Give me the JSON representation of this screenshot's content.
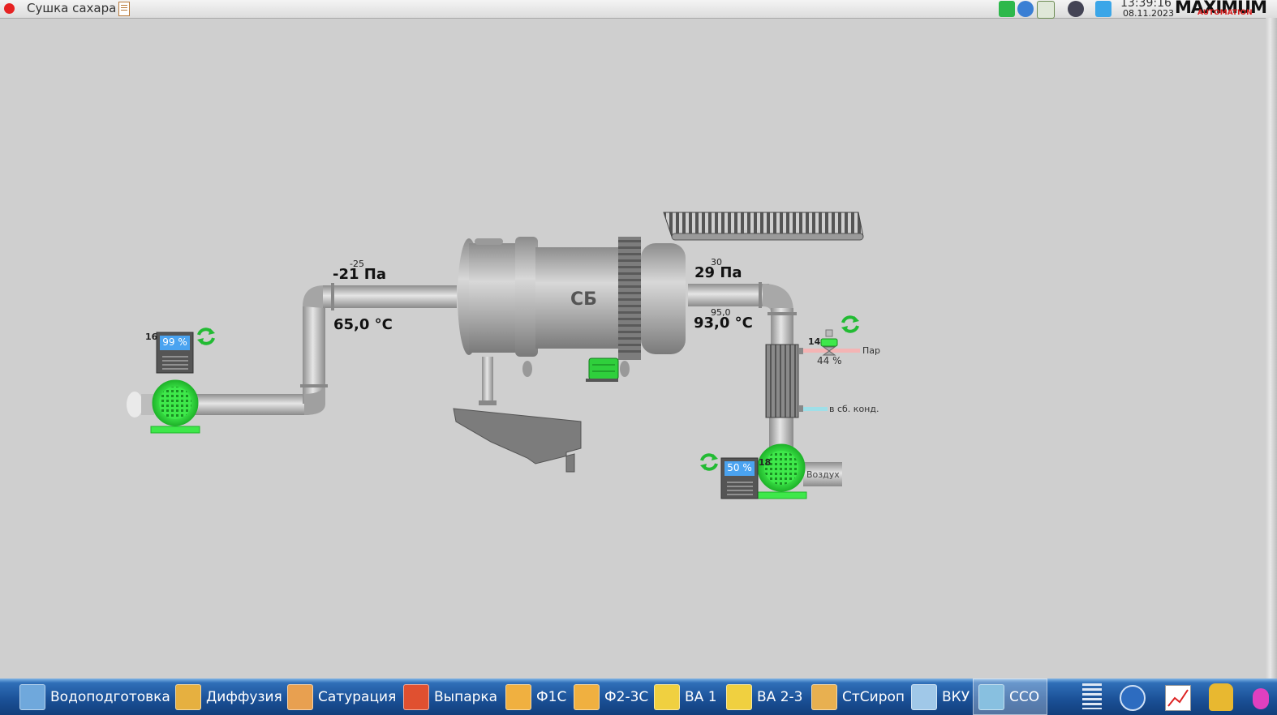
{
  "window": {
    "title": "Сушка сахара"
  },
  "clock": {
    "time": "13:39:16",
    "date": "08.11.2023"
  },
  "logo": {
    "text": "MAXIMUM",
    "subtext": "AUTOMATION"
  },
  "process": {
    "dryer_label": "СБ",
    "inlet": {
      "pressure": "-21 Па",
      "pressure_setpoint": "-25",
      "temperature": "65,0 °C"
    },
    "outlet": {
      "pressure": "29 Па",
      "pressure_setpoint": "30",
      "temperature": "93,0 °C",
      "temperature_setpoint": "95,0"
    },
    "fan_left": {
      "number": "16",
      "speed": "99 %"
    },
    "fan_right": {
      "number": "18",
      "speed": "50 %",
      "air_label": "Воздух"
    },
    "steam_valve": {
      "number": "14",
      "opening": "44 %",
      "steam_label": "Пар",
      "condensate_label": "в сб. конд."
    }
  },
  "taskbar": {
    "items": [
      {
        "label": "Водоподготовка",
        "color": "#6fa8dc"
      },
      {
        "label": "Диффузия",
        "color": "#e6b040"
      },
      {
        "label": "Сатурация",
        "color": "#e8a050"
      },
      {
        "label": "Выпарка",
        "color": "#e05030"
      },
      {
        "label": "Ф1С",
        "color": "#f0b040"
      },
      {
        "label": "Ф2-3С",
        "color": "#f0b040"
      },
      {
        "label": "ВА 1",
        "color": "#f0d040"
      },
      {
        "label": "ВА 2-3",
        "color": "#f0d040"
      },
      {
        "label": "СтСироп",
        "color": "#e8b050"
      },
      {
        "label": "ВКУ",
        "color": "#a0c8e8"
      },
      {
        "label": "ССО",
        "color": "#88c0e0"
      }
    ],
    "active": "ССО"
  },
  "colors": {
    "fan_green": "#3ee84a",
    "background": "#cfcfcf",
    "panel_blue": "#4aa3f0",
    "pipe": "#b3b3b3"
  }
}
